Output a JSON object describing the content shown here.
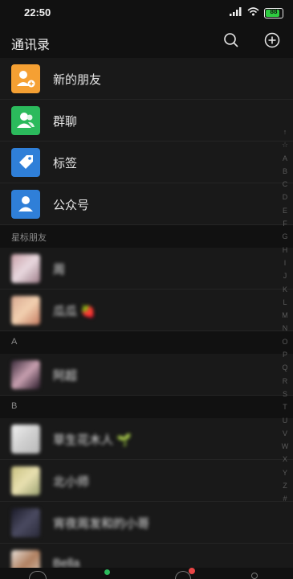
{
  "status": {
    "time": "22:50",
    "battery": "88"
  },
  "header": {
    "title": "通讯录"
  },
  "top_items": [
    {
      "label": "新的朋友",
      "icon": "add-friend-icon",
      "color": "#F5A033"
    },
    {
      "label": "群聊",
      "icon": "group-chat-icon",
      "color": "#2BBA5C"
    },
    {
      "label": "标签",
      "icon": "tag-icon",
      "color": "#2F7FD8"
    },
    {
      "label": "公众号",
      "icon": "official-account-icon",
      "color": "#2F7FD8"
    }
  ],
  "starred_section": "星标朋友",
  "contacts_starred": [
    {
      "name": "周"
    },
    {
      "name": "瓜瓜 🍓"
    }
  ],
  "section_a": "A",
  "contacts_a": [
    {
      "name": "阿超"
    }
  ],
  "section_b": "B",
  "contacts_b": [
    {
      "name": "草生花木人 🌱"
    },
    {
      "name": "北小师"
    },
    {
      "name": "宵夜周发和的小哥"
    },
    {
      "name": "Bella"
    }
  ],
  "alphabet_index": [
    "↑",
    "☆",
    "A",
    "B",
    "C",
    "D",
    "E",
    "F",
    "G",
    "H",
    "I",
    "J",
    "K",
    "L",
    "M",
    "N",
    "O",
    "P",
    "Q",
    "R",
    "S",
    "T",
    "U",
    "V",
    "W",
    "X",
    "Y",
    "Z",
    "#"
  ]
}
